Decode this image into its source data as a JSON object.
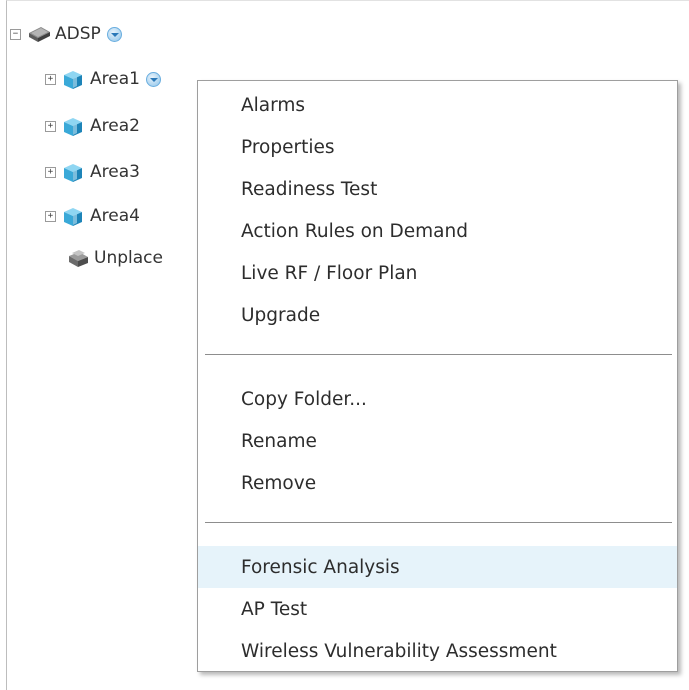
{
  "tree": {
    "root": {
      "label": "ADSP",
      "expander": "−",
      "icon": "server-icon"
    },
    "children": [
      {
        "label": "Area1",
        "expander": "+",
        "icon": "cube-folder-icon"
      },
      {
        "label": "Area2",
        "expander": "+",
        "icon": "cube-folder-icon"
      },
      {
        "label": "Area3",
        "expander": "+",
        "icon": "cube-folder-icon"
      },
      {
        "label": "Area4",
        "expander": "+",
        "icon": "cube-folder-icon"
      },
      {
        "label": "Unplace",
        "icon": "unplaced-folder-icon"
      }
    ]
  },
  "context_menu": {
    "items": [
      "Alarms",
      "Properties",
      "Readiness Test",
      "Action Rules on Demand",
      "Live RF / Floor Plan",
      "Upgrade",
      "Copy Folder...",
      "Rename",
      "Remove",
      "Forensic Analysis",
      "AP Test",
      "Wireless Vulnerability Assessment"
    ],
    "highlighted_item": "Forensic Analysis"
  },
  "colors": {
    "highlight": "#e6f3fa",
    "cube_icon": "#3aa9d8",
    "dropdown_button": "#8ec4ea"
  }
}
